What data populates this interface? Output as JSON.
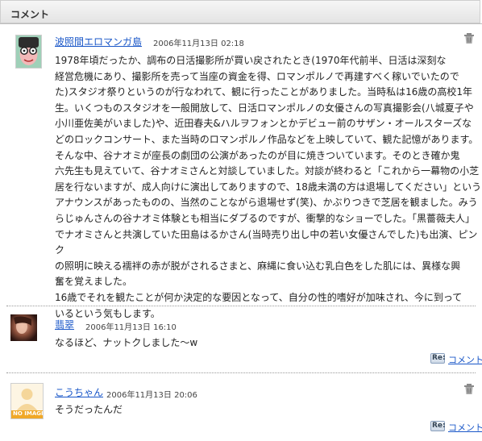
{
  "header": {
    "title": "コメント"
  },
  "comments": [
    {
      "name": "波照間エロマンガ島",
      "date": "2006年11月13日 02:18",
      "lines": [
        "1978年頃だったか、調布の日活撮影所が買い戻されたとき(1970年代前半、日活は深刻な",
        "経営危機にあり、撮影所を売って当座の資金を得、ロマンポルノで再建すべく稼いでいたので",
        "た)スタジオ祭りというのが行なわれて、観に行ったことがありました。当時私は16歳の高校1年",
        "生。いくつものスタジオを一般開放して、日活ロマンポルノの女優さんの写真撮影会(八城夏子や",
        "小川亜佐美がいました)や、近田春夫&ハルヲフォンとかデビュー前のサザン・オールスターズな",
        "どのロックコンサート、また当時のロマンポルノ作品などを上映していて、観た記憶があります。",
        "そんな中、谷ナオミが座長の劇団の公演があったのが目に焼きついています。そのとき確か鬼",
        "六先生も見えていて、谷ナオミさんと対談していました。対談が終わると「これから一幕物の小芝",
        "居を行ないますが、成人向けに演出してありますので、18歳未満の方は退場してください」という",
        "アナウンスがあったものの、当然のことながら退場せず(笑)、かぶりつきで芝居を観ました。みう",
        "らじゅんさんの谷ナオミ体験とも相当にダブるのですが、衝撃的なショーでした。「黒薔薇夫人」",
        "でナオミさんと共演していた田島はるかさん(当時売り出し中の若い女優さんでした)も出演、ピンク",
        "の照明に映える襦袢の赤が脱がされるさまと、麻縄に食い込む乳白色をした肌には、異様な興",
        "奮を覚えました。",
        "16歳でそれを観たことが何か決定的な要因となって、自分の性的嗜好が加味され、今に到って",
        "いるという気もします。"
      ],
      "avatar_icon": "cartoon-face-avatar"
    },
    {
      "name": "翡翠",
      "date": "2006年11月13日 16:10",
      "text": "なるほど、ナットクしました〜w",
      "reply_label": "コメント",
      "avatar_icon": "photo-avatar"
    },
    {
      "name": "こうちゃん",
      "date": "2006年11月13日 20:06",
      "text": "そうだったんだ",
      "reply_label": "コメント",
      "avatar_icon": "no-image-avatar",
      "avatar_text": "NO IMAGE"
    }
  ],
  "reply_icon_text": "Re:",
  "colors": {
    "link": "#1a57c8",
    "no_image": "#f0a828"
  }
}
